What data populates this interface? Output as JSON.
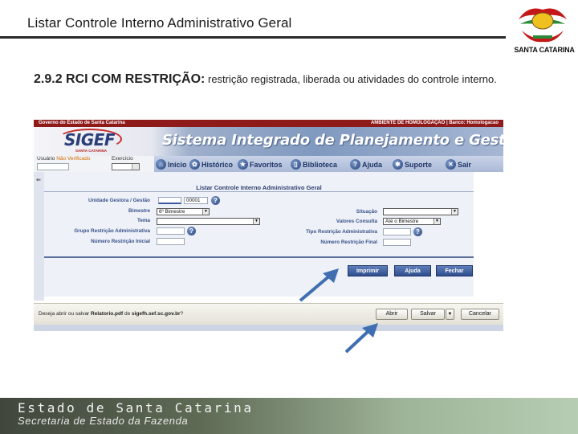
{
  "slide": {
    "title": "Listar Controle Interno Administrativo Geral",
    "logo_text": "SANTA CATARINA",
    "description_heading": "2.9.2 RCI COM RESTRIÇÃO:",
    "description_text": "restrição registrada, liberada ou atividades do controle interno."
  },
  "app": {
    "gov_bar_left": "Governo do Estado de Santa Catarina",
    "gov_bar_right": "AMBIENTE DE HOMOLOGAÇÃO | Banco: Homologacao",
    "logo_text": "SIGEF",
    "logo_subtext": "SANTA CATARINA",
    "system_title": "Sistema Integrado de Planejamento e Gestão Fiscal",
    "login": {
      "usuario_label": "Usuário",
      "usuario_value": "Não Verificado",
      "exercicio_label": "Exercício"
    },
    "menu": [
      {
        "label": "Início",
        "icon": "home-icon"
      },
      {
        "label": "Histórico",
        "icon": "history-icon"
      },
      {
        "label": "Favoritos",
        "icon": "star-icon"
      },
      {
        "label": "Biblioteca",
        "icon": "book-icon"
      },
      {
        "label": "Ajuda",
        "icon": "help-icon"
      },
      {
        "label": "Suporte",
        "icon": "support-icon"
      },
      {
        "label": "Sair",
        "icon": "exit-icon"
      }
    ]
  },
  "form": {
    "title": "Listar Controle Interno Administrativo Geral",
    "unidade_gestora_label": "Unidade Gestora / Gestão",
    "unidade_gestora_value": "",
    "gestao_value": "00001",
    "bimestre_label": "Bimestre",
    "bimestre_value": "6º Bimestre",
    "tema_label": "Tema",
    "tema_value": "",
    "grupo_restricao_label": "Grupo Restrição Administrativa",
    "numero_restricao_inicial_label": "Número Restrição Inicial",
    "situacao_label": "Situação",
    "situacao_value": "",
    "valores_consulta_label": "Valores Consulta",
    "valores_consulta_value": "Até o Bimestre",
    "tipo_restricao_label": "Tipo Restrição Administrativa",
    "numero_restricao_final_label": "Número Restrição Final",
    "buttons": {
      "imprimir": "Imprimir",
      "ajuda": "Ajuda",
      "fechar": "Fechar"
    }
  },
  "download_bar": {
    "prefix": "Deseja abrir ou salvar",
    "filename": "Relatorio.pdf",
    "from_word": "de",
    "site": "sigefh.sef.sc.gov.br",
    "suffix": "?",
    "abrir": "Abrir",
    "salvar": "Salvar",
    "cancelar": "Cancelar"
  },
  "footer": {
    "line1": "Estado de Santa Catarina",
    "line2": "Secretaria de Estado da Fazenda"
  },
  "colors": {
    "gov_bar": "#8e1a1a",
    "menu_text": "#1f3566",
    "form_label": "#39518a",
    "button_blue": "#2f4e8e",
    "arrow_blue": "#3f6fb0"
  }
}
